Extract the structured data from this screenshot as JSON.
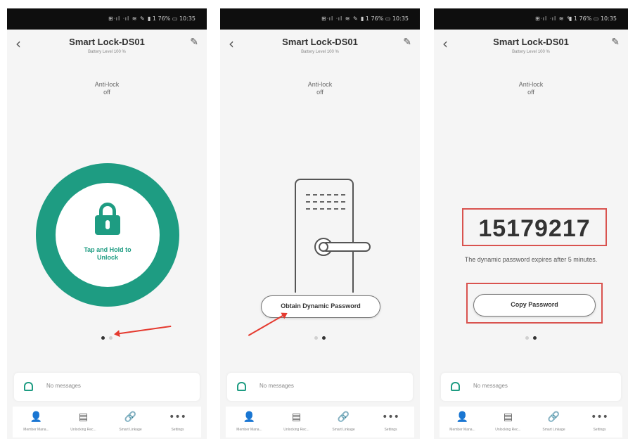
{
  "status": {
    "signal": "⊞ᐧıl ᐧıl ≋ ✎",
    "battery": "▮ 1 76% ▭ 10:35"
  },
  "header": {
    "back": "‹",
    "edit": "✎",
    "title": "Smart Lock-DS01",
    "battery_level": "Battery Level 100 %"
  },
  "antilock": {
    "label": "Anti-lock",
    "value": "off"
  },
  "unlock": {
    "label": "Tap and Hold to Unlock"
  },
  "buttons": {
    "obtain": "Obtain Dynamic Password",
    "copy": "Copy Password"
  },
  "password": {
    "code": "15179217",
    "expire": "The dynamic password expires after 5 minutes."
  },
  "messages": {
    "text": "No messages"
  },
  "tabs": [
    {
      "icon": "person-icon",
      "glyph": "👤",
      "label": "Member Mana..."
    },
    {
      "icon": "document-icon",
      "glyph": "▤",
      "label": "Unlocking Rec..."
    },
    {
      "icon": "link-icon",
      "glyph": "🔗",
      "label": "Smart Linkage"
    },
    {
      "icon": "more-icon",
      "glyph": "•••",
      "label": "Settings"
    }
  ],
  "colors": {
    "accent": "#1e9c82",
    "highlight": "#d9534f"
  }
}
